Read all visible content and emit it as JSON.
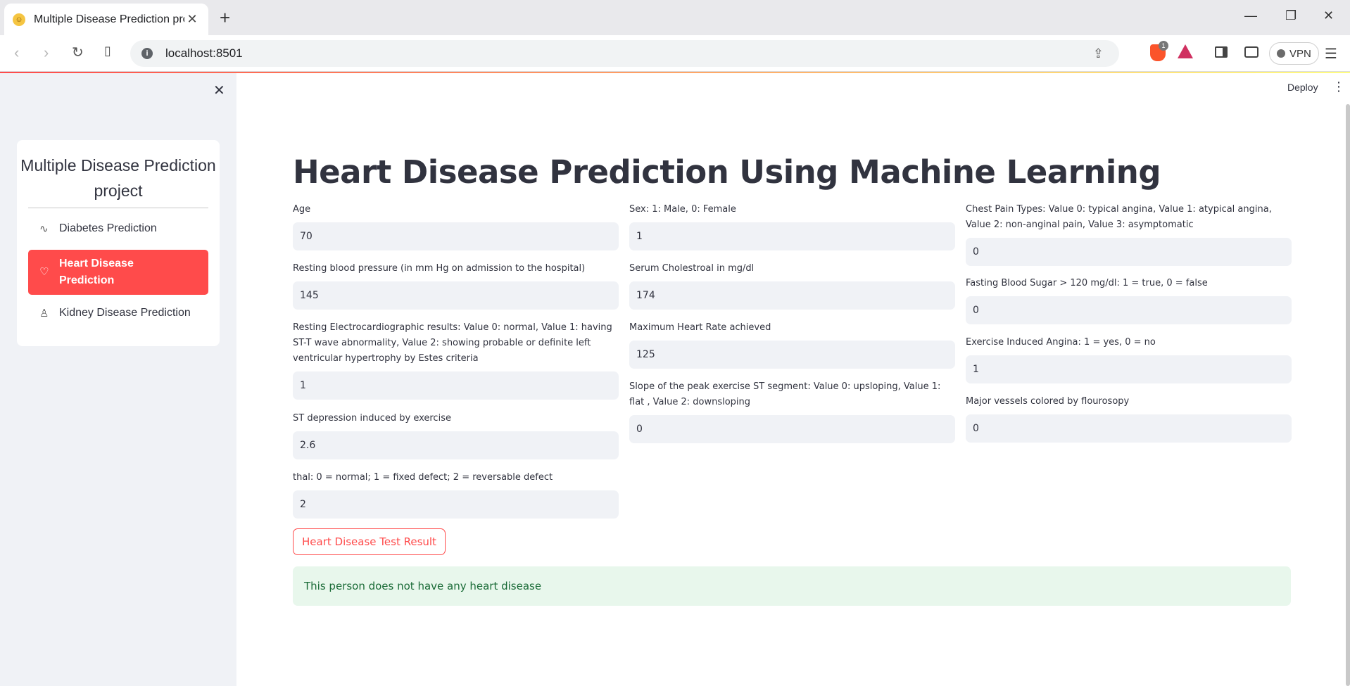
{
  "browser": {
    "tab_title": "Multiple Disease Prediction proj",
    "url": "localhost:8501",
    "extension_badge": "1",
    "vpn_label": "VPN"
  },
  "sidebar": {
    "menu_title": "Multiple Disease Prediction project",
    "items": [
      {
        "label": "Diabetes Prediction",
        "icon": "activity-icon"
      },
      {
        "label": "Heart Disease Prediction",
        "icon": "heart-icon"
      },
      {
        "label": "Kidney Disease Prediction",
        "icon": "person-icon"
      }
    ],
    "active_index": 1
  },
  "header": {
    "deploy_label": "Deploy"
  },
  "main": {
    "title": "Heart Disease Prediction Using Machine Learning",
    "fields": {
      "age": {
        "label": "Age",
        "value": "70"
      },
      "sex": {
        "label": "Sex: 1: Male, 0: Female",
        "value": "1"
      },
      "cp": {
        "label": "Chest Pain Types: Value 0: typical angina, Value 1: atypical angina, Value 2: non-anginal pain, Value 3: asymptomatic",
        "value": "0"
      },
      "trestbps": {
        "label": "Resting blood pressure (in mm Hg on admission to the hospital)",
        "value": "145"
      },
      "chol": {
        "label": "Serum Cholestroal in mg/dl",
        "value": "174"
      },
      "fbs": {
        "label": "Fasting Blood Sugar > 120 mg/dl: 1 = true, 0 = false",
        "value": "0"
      },
      "restecg": {
        "label": "Resting Electrocardiographic results: Value 0: normal, Value 1: having ST-T wave abnormality, Value 2: showing probable or definite left ventricular hypertrophy by Estes criteria",
        "value": "1"
      },
      "thalach": {
        "label": "Maximum Heart Rate achieved",
        "value": "125"
      },
      "exang": {
        "label": "Exercise Induced Angina: 1 = yes, 0 = no",
        "value": "1"
      },
      "oldpeak": {
        "label": "ST depression induced by exercise",
        "value": "2.6"
      },
      "slope": {
        "label": "Slope of the peak exercise ST segment: Value 0: upsloping, Value 1: flat , Value 2: downsloping",
        "value": "0"
      },
      "ca": {
        "label": "Major vessels colored by flourosopy",
        "value": "0"
      },
      "thal": {
        "label": "thal: 0 = normal; 1 = fixed defect; 2 = reversable defect",
        "value": "2"
      }
    },
    "button_label": "Heart Disease Test Result",
    "result_message": "This person does not have any heart disease"
  },
  "colors": {
    "accent": "#ff4b4b",
    "success_bg": "#e8f7ec",
    "success_text": "#1a6b37",
    "sidebar_bg": "#f0f2f6"
  }
}
